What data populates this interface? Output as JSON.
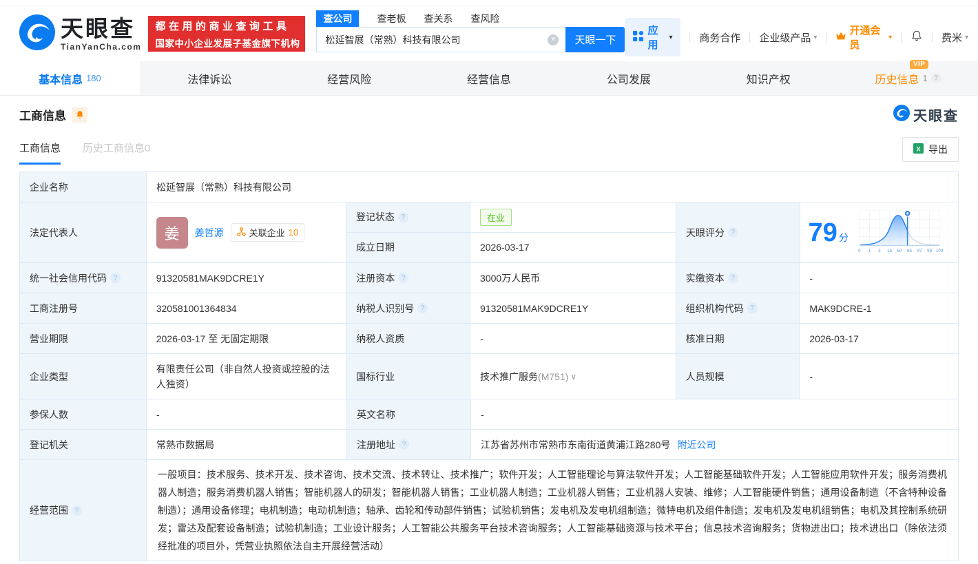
{
  "header": {
    "logo_text": "天眼查",
    "logo_domain": "TianYanCha.com",
    "banner_line1": "都在用的商业查询工具",
    "banner_line2": "国家中小企业发展子基金旗下机构",
    "search_tabs": [
      {
        "label": "查公司"
      },
      {
        "label": "查老板"
      },
      {
        "label": "查关系"
      },
      {
        "label": "查风险"
      }
    ],
    "search_value": "松延智展（常熟）科技有限公司",
    "search_button": "天眼一下",
    "nav_app": "应用",
    "nav_cooperation": "商务合作",
    "nav_enterprise": "企业级产品",
    "nav_vip": "开通会员",
    "nav_user": "费米"
  },
  "tabs": {
    "basic": {
      "label": "基本信息",
      "count": "180"
    },
    "legal": {
      "label": "法律诉讼"
    },
    "risk": {
      "label": "经营风险"
    },
    "operation": {
      "label": "经营信息"
    },
    "development": {
      "label": "公司发展"
    },
    "ip": {
      "label": "知识产权"
    },
    "history": {
      "label": "历史信息",
      "count": "1",
      "badge": "VIP"
    }
  },
  "section": {
    "title": "工商信息",
    "subtab_current": "工商信息",
    "subtab_history": "历史工商信息0",
    "export_label": "导出",
    "watermark": "天眼查"
  },
  "info": {
    "company_name_label": "企业名称",
    "company_name": "松延智展（常熟）科技有限公司",
    "legal_rep_label": "法定代表人",
    "legal_rep_avatar": "姜",
    "legal_rep_name": "姜哲源",
    "related_label": "关联企业",
    "related_count": "10",
    "reg_status_label": "登记状态",
    "reg_status": "在业",
    "establish_label": "成立日期",
    "establish_date": "2026-03-17",
    "score_label": "天眼评分",
    "score_value": "79",
    "score_unit": "分",
    "credit_code_label": "统一社会信用代码",
    "credit_code": "91320581MAK9DCRE1Y",
    "reg_capital_label": "注册资本",
    "reg_capital": "3000万人民币",
    "paid_capital_label": "实缴资本",
    "paid_capital": "-",
    "reg_number_label": "工商注册号",
    "reg_number": "320581001364834",
    "taxpayer_id_label": "纳税人识别号",
    "taxpayer_id": "91320581MAK9DCRE1Y",
    "org_code_label": "组织机构代码",
    "org_code": "MAK9DCRE-1",
    "business_term_label": "营业期限",
    "business_term": "2026-03-17 至 无固定期限",
    "taxpayer_quality_label": "纳税人资质",
    "taxpayer_quality": "-",
    "approval_date_label": "核准日期",
    "approval_date": "2026-03-17",
    "company_type_label": "企业类型",
    "company_type": "有限责任公司（非自然人投资或控股的法人独资）",
    "industry_label": "国标行业",
    "industry": "技术推广服务",
    "industry_code": "(M751)",
    "staff_size_label": "人员规模",
    "staff_size": "-",
    "insured_label": "参保人数",
    "insured": "-",
    "english_name_label": "英文名称",
    "english_name": "-",
    "reg_authority_label": "登记机关",
    "reg_authority": "常熟市数据局",
    "reg_address_label": "注册地址",
    "reg_address": "江苏省苏州市常熟市东南街道黄浦江路280号",
    "nearby_link": "附近公司",
    "business_scope_label": "经营范围",
    "business_scope": "一般项目：技术服务、技术开发、技术咨询、技术交流、技术转让、技术推广；软件开发；人工智能理论与算法软件开发；人工智能基础软件开发；人工智能应用软件开发；服务消费机器人制造；服务消费机器人销售；智能机器人的研发；智能机器人销售；工业机器人制造；工业机器人销售；工业机器人安装、维修；人工智能硬件销售；通用设备制造（不含特种设备制造）；通用设备修理；电机制造；电动机制造；轴承、齿轮和传动部件销售；试验机销售；发电机及发电机组制造；微特电机及组件制造；发电机及发电机组销售；电机及其控制系统研发；雷达及配套设备制造；试验机制造；工业设计服务；人工智能公共服务平台技术咨询服务；人工智能基础资源与技术平台；信息技术咨询服务；货物进出口；技术进出口（除依法须经批准的项目外，凭营业执照依法自主开展经营活动）"
  },
  "chart_data": {
    "type": "area",
    "title": "天眼评分分布曲线",
    "x_labels": [
      "0",
      "1",
      "3",
      "15",
      "50",
      "85",
      "97",
      "99",
      "100"
    ],
    "marker_value": 79,
    "xlim": [
      0,
      100
    ],
    "grid": true,
    "legend": "none"
  },
  "icons": {
    "clear_glyph": "✕",
    "caret_down_glyph": "▾",
    "question_glyph": "?",
    "chevron_glyph": "∨"
  },
  "colors": {
    "brand_blue": "#127fff",
    "banner_red": "#e12e2e",
    "vip_orange": "#ff8a00",
    "status_green": "#52c41a",
    "label_bg": "#eef5fb"
  }
}
